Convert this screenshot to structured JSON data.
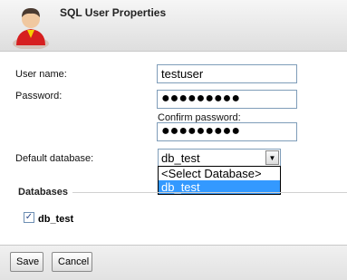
{
  "dialog": {
    "title": "SQL User Properties"
  },
  "form": {
    "username_label": "User name:",
    "username_value": "testuser",
    "password_label": "Password:",
    "password_value": "●●●●●●●●●",
    "confirm_label": "Confirm password:",
    "confirm_value": "●●●●●●●●●",
    "default_db_label": "Default database:",
    "default_db_value": "db_test",
    "default_db_options": [
      "<Select Database>",
      "db_test"
    ]
  },
  "databases": {
    "section_title": "Databases",
    "items": [
      {
        "label": "db_test",
        "checked": true
      }
    ]
  },
  "buttons": {
    "save": "Save",
    "cancel": "Cancel"
  },
  "icons": {
    "avatar": "user-avatar-icon",
    "checkbox": "checkmark-icon",
    "select_arrow": "chevron-down-icon"
  },
  "colors": {
    "selection": "#3399ff",
    "input_border": "#7f9db9"
  }
}
